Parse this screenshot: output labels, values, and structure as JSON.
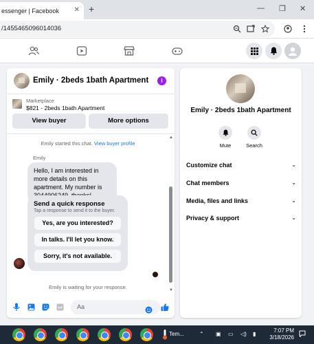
{
  "browser": {
    "tab_title": "essenger | Facebook",
    "url": "/1455465096014036",
    "new_tab": "+",
    "tab_close": "✕",
    "win_min": "—",
    "win_max": "❐",
    "win_close": "✕"
  },
  "chat": {
    "title": "Emily · 2beds 1bath Apartment",
    "info_icon": "i",
    "marketplace_label": "Marketplace",
    "listing": "$821 - 2beds 1bath Apartment",
    "view_buyer": "View buyer",
    "more_options": "More options",
    "started_text": "Emily started this chat.",
    "view_profile_link": "View buyer profile",
    "sender": "Emily",
    "message": "Hello, I am interested in more details on this apartment. My number is 3044906249, thanks!",
    "quick_response": {
      "title": "Send a quick response",
      "subtitle": "Tap a response to send it to the buyer.",
      "options": [
        "Yes, are you interested?",
        "In talks. I'll let you know.",
        "Sorry, it's not available."
      ]
    },
    "waiting_text": "Emily is waiting for your response.",
    "composer_placeholder": "Aa"
  },
  "info_panel": {
    "name": "Emily · 2beds 1bath Apartment",
    "mute": "Mute",
    "search": "Search",
    "sections": [
      "Customize chat",
      "Chat members",
      "Media, files and links",
      "Privacy & support"
    ]
  },
  "taskbar": {
    "temp": "Tem...",
    "time": "7:07 PM",
    "date": "3/18/2026"
  },
  "colors": {
    "accent": "#1877f2",
    "info_purple": "#9b1fe8",
    "bubble_gray": "#e4e6eb"
  }
}
